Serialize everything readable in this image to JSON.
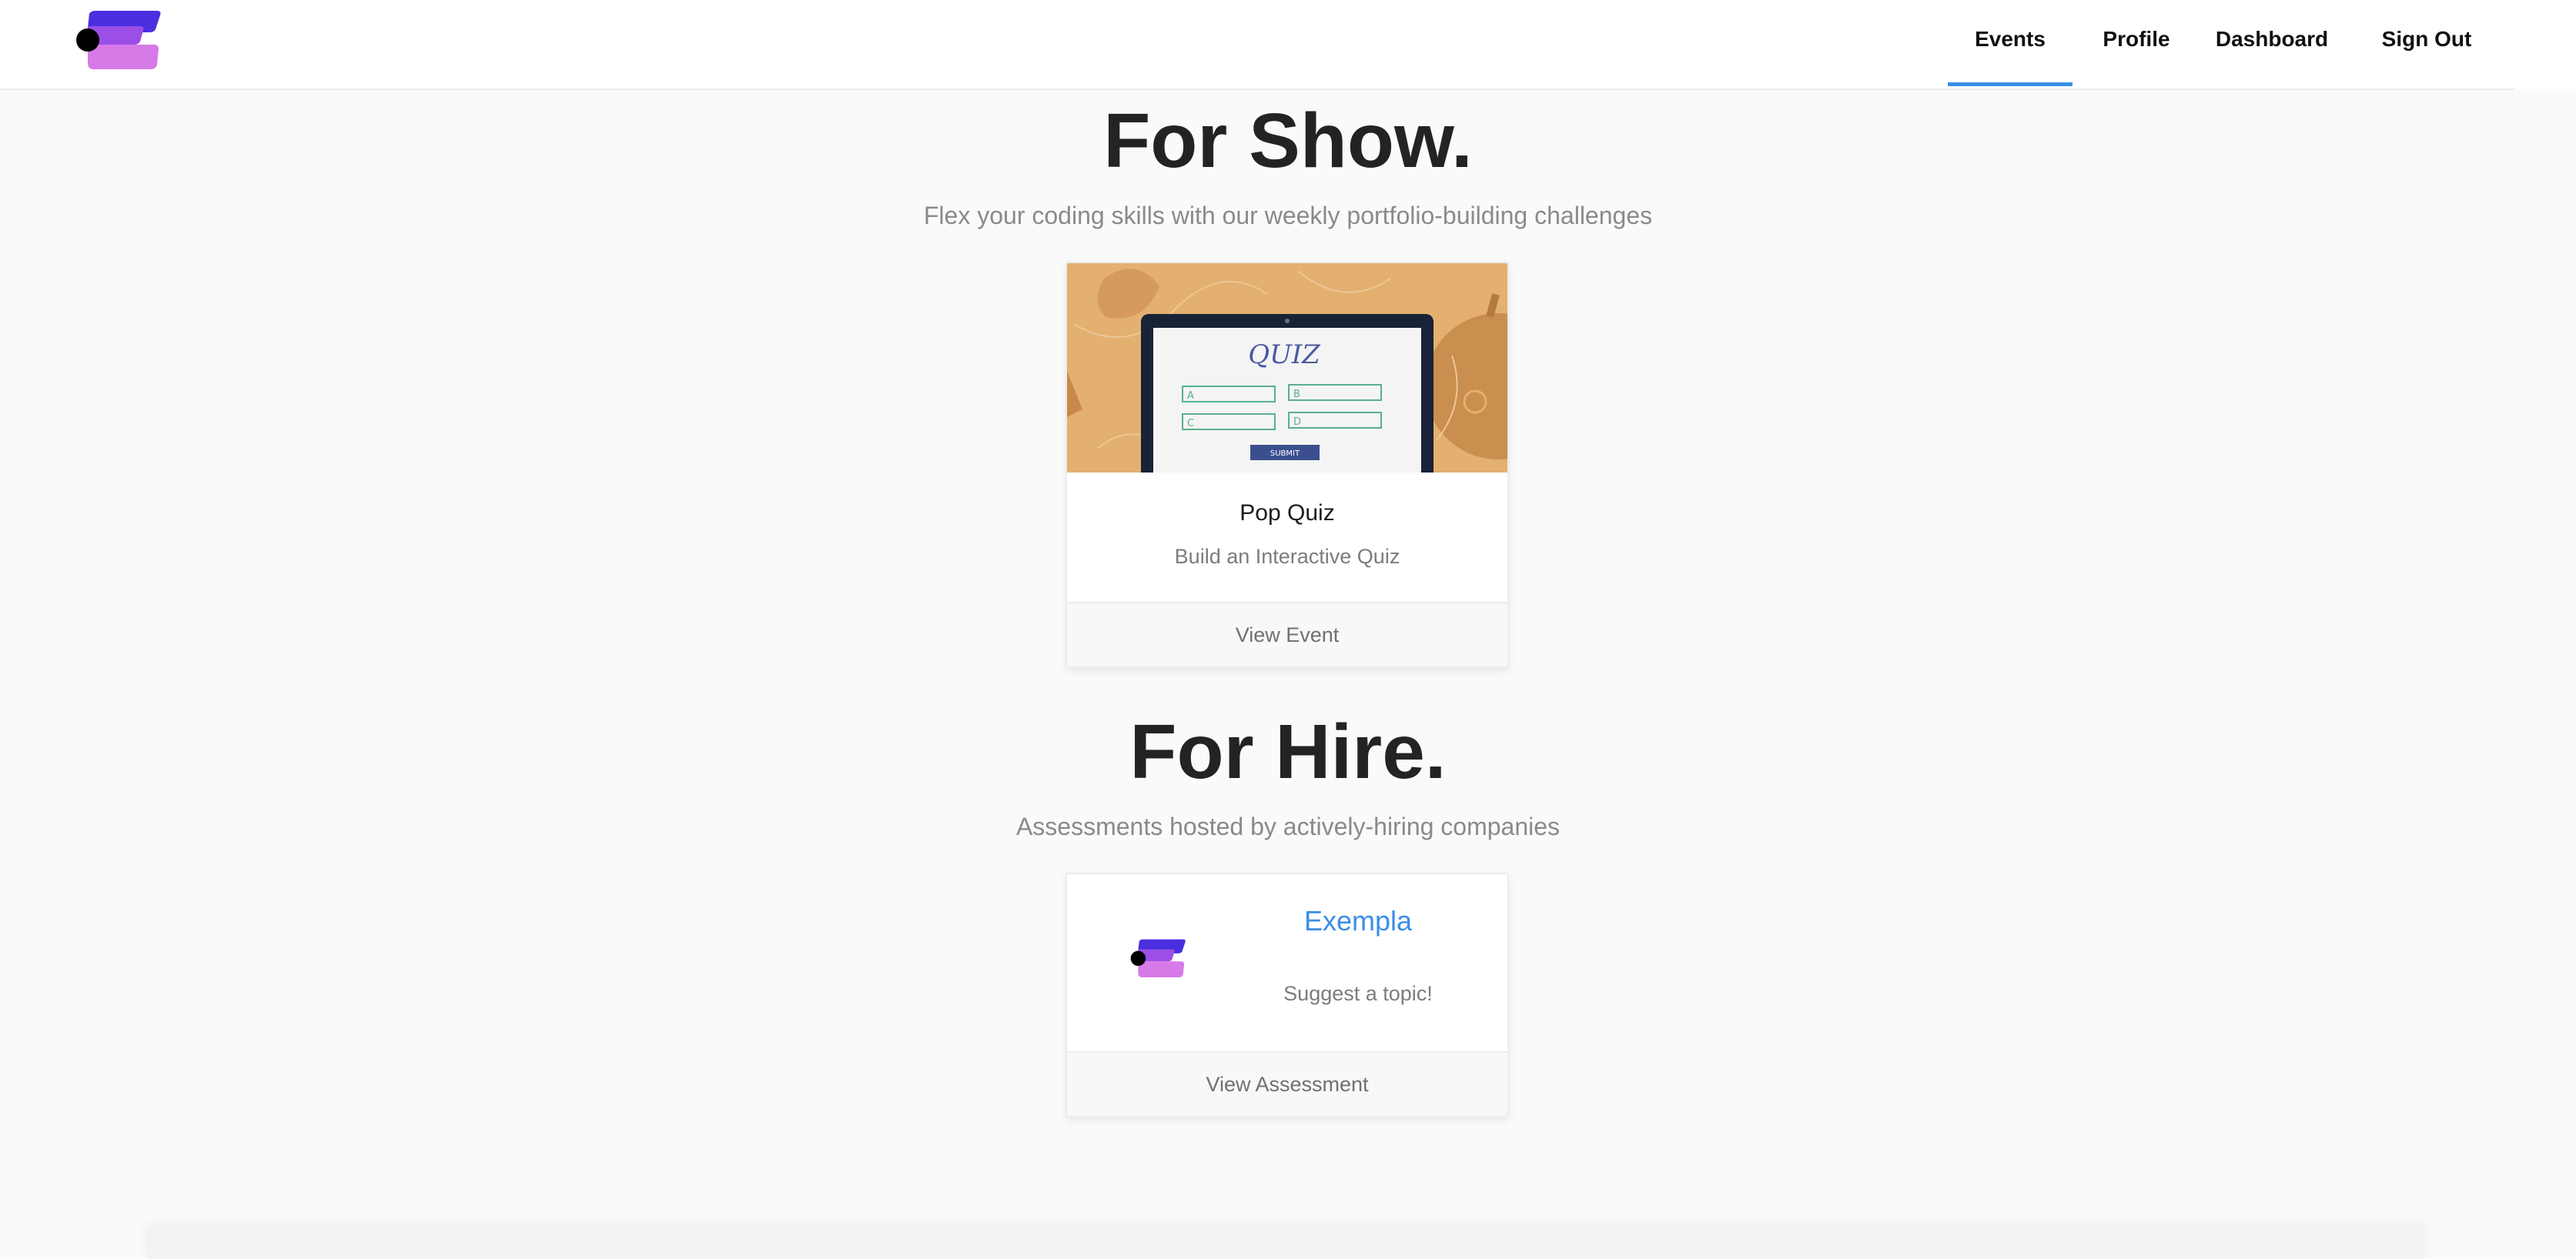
{
  "header": {
    "logo_name": "app-logo",
    "nav": [
      {
        "label": "Events",
        "active": true
      },
      {
        "label": "Profile",
        "active": false
      },
      {
        "label": "Dashboard",
        "active": false
      },
      {
        "label": "Sign Out",
        "active": false
      }
    ]
  },
  "show_section": {
    "title": "For Show.",
    "subtitle": "Flex your coding skills with our weekly portfolio-building challenges",
    "card": {
      "image": {
        "quiz_heading": "QUIZ",
        "options": [
          "A",
          "B",
          "C",
          "D"
        ],
        "submit_label": "SUBMIT"
      },
      "title": "Pop Quiz",
      "description": "Build an Interactive Quiz",
      "action": "View Event"
    }
  },
  "hire_section": {
    "title": "For Hire.",
    "subtitle": "Assessments hosted by actively-hiring companies",
    "card": {
      "company": "Exempla",
      "topic": "Suggest a topic!",
      "action": "View Assessment"
    }
  },
  "colors": {
    "accent_blue": "#3a8ee6",
    "logo_purple": "#4a2fe0",
    "logo_pink": "#d77ae8",
    "quiz_bg": "#e3b06f"
  }
}
